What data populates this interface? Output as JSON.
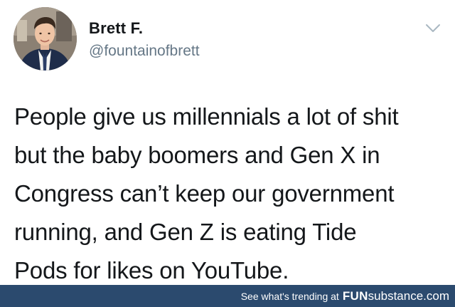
{
  "tweet": {
    "display_name": "Brett F.",
    "handle": "@fountainofbrett",
    "text_lines": [
      "People give us millennials a lot of shit",
      "but the baby boomers and Gen X in",
      "Congress can’t keep our government",
      "running, and Gen Z is eating Tide",
      "Pods for likes on YouTube."
    ]
  },
  "footer": {
    "trending_text": "See what's trending at",
    "brand_part1": "FUN",
    "brand_part2": "substance",
    "brand_part3": ".com"
  },
  "icons": {
    "avatar": "profile-photo",
    "menu": "chevron-down-icon"
  },
  "colors": {
    "handle": "#657786",
    "text": "#14171a",
    "footer_background": "#2b4a6e"
  }
}
